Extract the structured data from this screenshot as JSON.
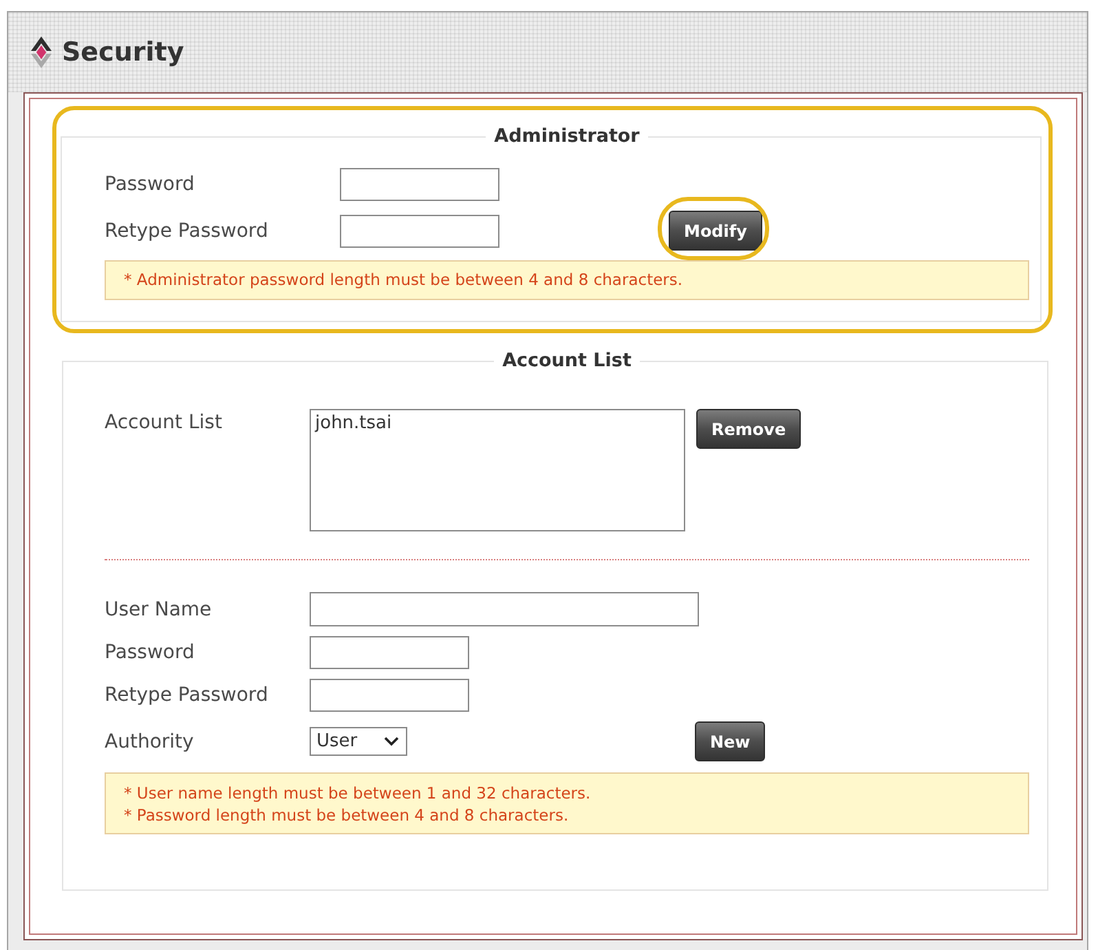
{
  "header": {
    "title": "Security"
  },
  "administrator": {
    "legend": "Administrator",
    "highlighted": true,
    "fields": [
      {
        "label": "Password",
        "kind": "password"
      },
      {
        "label": "Retype Password",
        "kind": "password"
      }
    ],
    "button": {
      "label": "Modify",
      "highlighted": true
    },
    "notes": [
      "* Administrator password length must be between 4 and 8 characters."
    ]
  },
  "account_list": {
    "legend": "Account List",
    "list": {
      "label": "Account List",
      "items": [
        {
          "text": "john.tsai",
          "selected": false
        }
      ]
    },
    "remove_button": {
      "label": "Remove"
    },
    "fields": [
      {
        "label": "User Name",
        "kind": "text"
      },
      {
        "label": "Password",
        "kind": "password"
      },
      {
        "label": "Retype Password",
        "kind": "password"
      },
      {
        "label": "Authority",
        "kind": "select",
        "value": "User"
      }
    ],
    "new_button": {
      "label": "New"
    },
    "notes": [
      "* User name length must be between 1 and 32 characters.",
      "* Password length must be between 4 and 8 characters."
    ]
  }
}
